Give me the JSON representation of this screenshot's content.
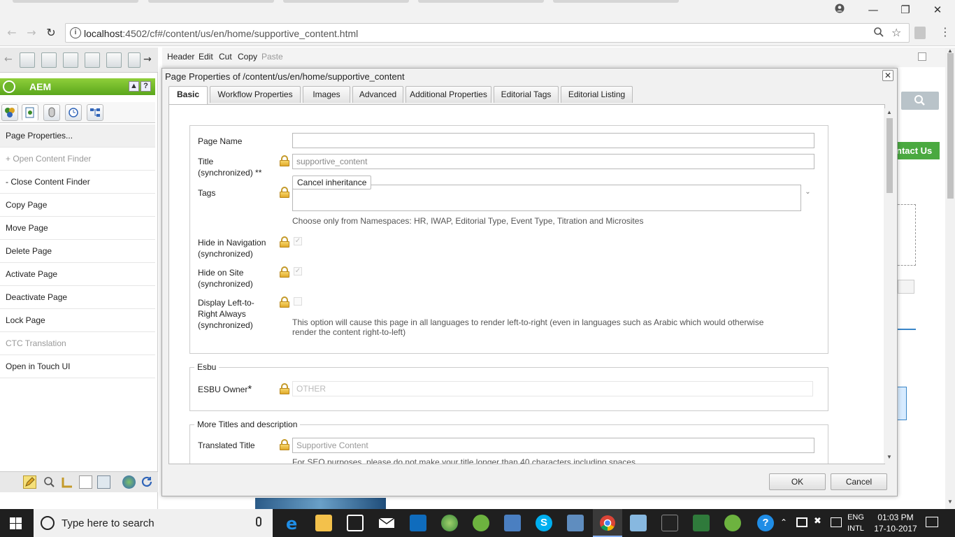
{
  "browser": {
    "url_host": "localhost",
    "url_path": ":4502/cf#/content/us/en/home/supportive_content.html",
    "controls": [
      "minimize",
      "restore",
      "close"
    ]
  },
  "editbar": {
    "items": [
      "Header",
      "Edit",
      "Cut",
      "Copy",
      "Paste"
    ]
  },
  "sidekick": {
    "title": "AEM",
    "menu": [
      "Page Properties...",
      "+ Open Content Finder",
      "- Close Content Finder",
      "Copy Page",
      "Move Page",
      "Delete Page",
      "Activate Page",
      "Deactivate Page",
      "Lock Page",
      "CTC Translation",
      "Open in Touch UI"
    ]
  },
  "background_page": {
    "contact_label": "ntact Us"
  },
  "dialog": {
    "title": "Page Properties of /content/us/en/home/supportive_content",
    "tabs": [
      "Basic",
      "Workflow Properties",
      "Images",
      "Advanced",
      "Additional Properties",
      "Editorial Tags",
      "Editorial Listing"
    ],
    "fields": {
      "page_name_label": "Page Name",
      "page_name_value": "",
      "title_label": "Title (synchronized)",
      "title_marker": "**",
      "title_value": "supportive_content",
      "tooltip": "Cancel inheritance",
      "tags_label": "Tags",
      "tags_hint": "Choose only from Namespaces: HR, IWAP, Editorial Type, Event Type, Titration and Microsites",
      "hide_nav_label": "Hide in Navigation (synchronized)",
      "hide_site_label": "Hide on Site (synchronized)",
      "ltr_label": "Display Left-to-Right Always (synchronized)",
      "ltr_hint": "This option will cause this page in all languages to render left-to-right (even in languages such as Arabic which would otherwise render the content right-to-left)"
    },
    "esbu": {
      "legend": "Esbu",
      "owner_label": "ESBU Owner",
      "owner_marker": "*",
      "owner_value": "OTHER"
    },
    "more_titles": {
      "legend": "More Titles and description",
      "translated_label": "Translated Title",
      "translated_value": "Supportive Content",
      "seo_hint": "For SEO purposes, please do not make your title longer than 40 characters including spaces"
    },
    "buttons": {
      "ok": "OK",
      "cancel": "Cancel"
    }
  },
  "taskbar": {
    "search_placeholder": "Type here to search",
    "lang_top": "ENG",
    "lang_bottom": "INTL",
    "time": "01:03 PM",
    "date": "17-10-2017"
  },
  "colors": {
    "aem_green": "#6cb52a",
    "taskbar": "#1f1f1f",
    "lock_gold": "#e0a92a"
  }
}
